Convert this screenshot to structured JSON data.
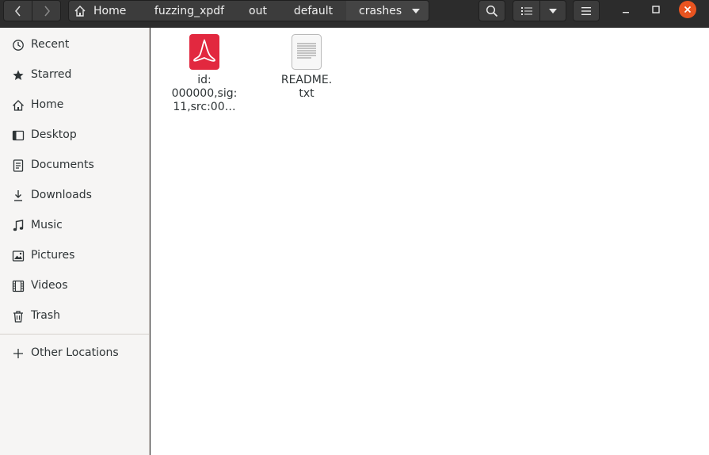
{
  "nav": {
    "back": "back-arrow",
    "forward": "forward-arrow"
  },
  "breadcrumb": [
    "Home",
    "fuzzing_xpdf",
    "out",
    "default",
    "crashes"
  ],
  "sidebar": {
    "items": [
      {
        "label": "Recent",
        "icon": "clock-icon"
      },
      {
        "label": "Starred",
        "icon": "star-icon"
      },
      {
        "label": "Home",
        "icon": "home-icon"
      },
      {
        "label": "Desktop",
        "icon": "desktop-icon"
      },
      {
        "label": "Documents",
        "icon": "documents-icon"
      },
      {
        "label": "Downloads",
        "icon": "downloads-icon"
      },
      {
        "label": "Music",
        "icon": "music-icon"
      },
      {
        "label": "Pictures",
        "icon": "pictures-icon"
      },
      {
        "label": "Videos",
        "icon": "videos-icon"
      },
      {
        "label": "Trash",
        "icon": "trash-icon"
      }
    ],
    "other": {
      "label": "Other Locations",
      "icon": "plus-icon"
    }
  },
  "files": [
    {
      "name_line1": "id:",
      "name_line2": "000000,sig:",
      "name_line3": "11,src:00…",
      "type": "pdf"
    },
    {
      "name_line1": "README.",
      "name_line2": "txt",
      "type": "text"
    }
  ],
  "colors": {
    "headerbar": "#2c2c2c",
    "close": "#e95420",
    "pdf": "#e2283f",
    "sidebar": "#f6f5f4"
  }
}
